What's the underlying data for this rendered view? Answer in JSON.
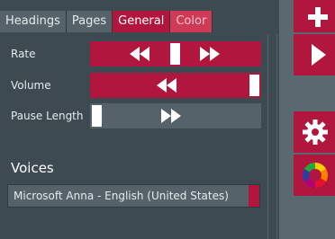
{
  "tabs": [
    {
      "label": "Headings",
      "active": false
    },
    {
      "label": "Pages",
      "active": false
    },
    {
      "label": "General",
      "active": true
    },
    {
      "label": "Color",
      "active": false
    }
  ],
  "settings": {
    "rate": {
      "label": "Rate",
      "value": 0.5
    },
    "volume": {
      "label": "Volume",
      "value": 1.0
    },
    "pause_length": {
      "label": "Pause Length",
      "value": 0.0
    }
  },
  "voices": {
    "title": "Voices",
    "selected": "Microsoft Anna - English (United States)"
  },
  "rail": {
    "buttons": [
      "plus-icon",
      "play-icon",
      "gear-icon",
      "color-wheel-icon"
    ]
  },
  "colors": {
    "accent": "#b0163e",
    "panel": "#3d4a52",
    "control": "#55626a",
    "rail": "#5a6870"
  }
}
